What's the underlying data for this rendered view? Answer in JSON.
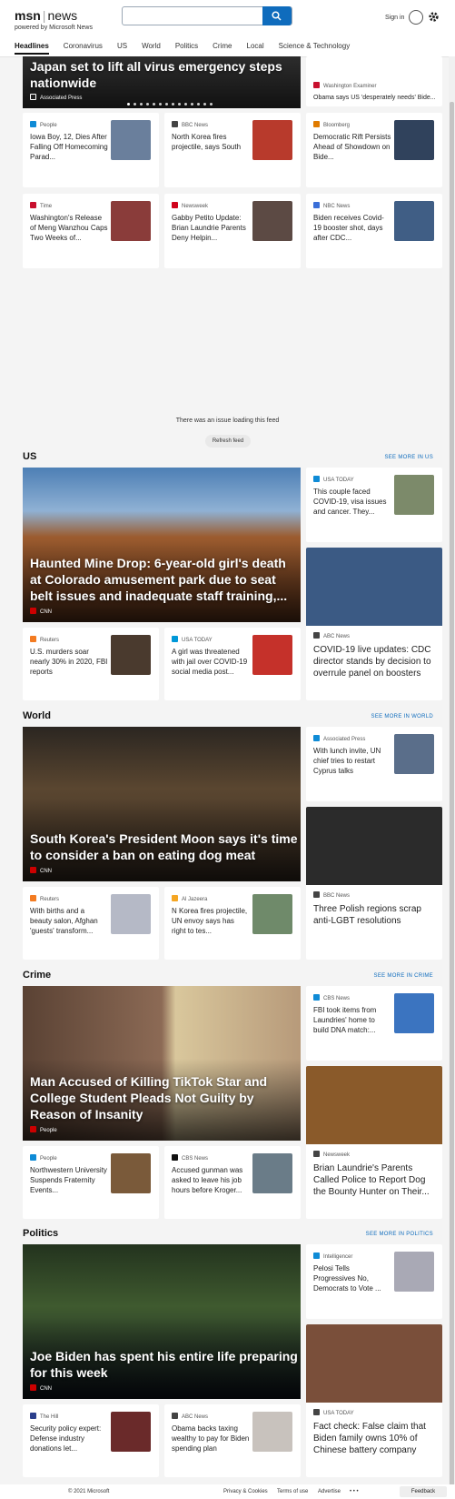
{
  "header": {
    "logo_brand": "msn",
    "logo_section": "news",
    "powered_by": "powered by Microsoft News",
    "search": {
      "value": "",
      "placeholder": ""
    },
    "sign_in": "Sign in"
  },
  "nav": [
    "Headlines",
    "Coronavirus",
    "US",
    "World",
    "Politics",
    "Crime",
    "Local",
    "Science & Technology"
  ],
  "top": {
    "hero_title": "Japan set to lift all virus emergency steps nationwide",
    "hero_source": "Associated Press",
    "side": {
      "source": "Washington Examiner",
      "title": "Obama says US 'desperately needs' Bide..."
    },
    "row1": [
      {
        "source": "People",
        "title": "Iowa Boy, 12, Dies After Falling Off Homecoming Parad..."
      },
      {
        "source": "BBC News",
        "title": "North Korea fires projectile, says South"
      },
      {
        "source": "Bloomberg",
        "title": "Democratic Rift Persists Ahead of Showdown on Bide..."
      }
    ],
    "row2": [
      {
        "source": "Time",
        "title": "Washington's Release of Meng Wanzhou Caps Two Weeks of..."
      },
      {
        "source": "Newsweek",
        "title": "Gabby Petito Update: Brian Laundrie Parents Deny Helpin..."
      },
      {
        "source": "NBC News",
        "title": "Biden receives Covid-19 booster shot, days after CDC..."
      }
    ]
  },
  "feed": {
    "issue": "There was an issue loading this feed",
    "refresh": "Refresh feed"
  },
  "sections": [
    {
      "name": "US",
      "more": "SEE MORE IN US",
      "hero_title": "Haunted Mine Drop: 6-year-old girl's death at Colorado amusement park due to seat belt issues and inadequate staff training,...",
      "hero_source": "CNN",
      "side1": {
        "source": "USA TODAY",
        "title": "This couple faced COVID-19, visa issues and cancer. They..."
      },
      "side2": {
        "source": "ABC News",
        "title": "COVID-19 live updates: CDC director stands by decision to overrule panel on boosters"
      },
      "small": [
        {
          "source": "Reuters",
          "title": "U.S. murders soar nearly 30% in 2020, FBI reports"
        },
        {
          "source": "USA TODAY",
          "title": "A girl was threatened with jail over COVID-19 social media post..."
        }
      ]
    },
    {
      "name": "World",
      "more": "SEE MORE IN WORLD",
      "hero_title": "South Korea's President Moon says it's time to consider a ban on eating dog meat",
      "hero_source": "CNN",
      "side1": {
        "source": "Associated Press",
        "title": "With lunch invite, UN chief tries to restart Cyprus talks"
      },
      "side2": {
        "source": "BBC News",
        "title": "Three Polish regions scrap anti-LGBT resolutions"
      },
      "small": [
        {
          "source": "Reuters",
          "title": "With births and a beauty salon, Afghan 'guests' transform..."
        },
        {
          "source": "Al Jazeera",
          "title": "N Korea fires projectile, UN envoy says has right to tes..."
        }
      ]
    },
    {
      "name": "Crime",
      "more": "SEE MORE IN CRIME",
      "hero_title": "Man Accused of Killing TikTok Star and College Student Pleads Not Guilty by Reason of Insanity",
      "hero_source": "People",
      "side1": {
        "source": "CBS News",
        "title": "FBI took items from Laundries' home to build DNA match:..."
      },
      "side2": {
        "source": "Newsweek",
        "title": "Brian Laundrie's Parents Called Police to Report Dog the Bounty Hunter on Their..."
      },
      "small": [
        {
          "source": "People",
          "title": "Northwestern University Suspends Fraternity Events..."
        },
        {
          "source": "CBS News",
          "title": "Accused gunman was asked to leave his job hours before Kroger..."
        }
      ]
    },
    {
      "name": "Politics",
      "more": "SEE MORE IN POLITICS",
      "hero_title": "Joe Biden has spent his entire life preparing for this week",
      "hero_source": "CNN",
      "side1": {
        "source": "Intelligencer",
        "title": "Pelosi Tells Progressives No, Democrats to Vote ..."
      },
      "side2": {
        "source": "USA TODAY",
        "title": "Fact check: False claim that Biden family owns 10% of Chinese battery company"
      },
      "small": [
        {
          "source": "The Hill",
          "title": "Security policy expert: Defense industry donations let..."
        },
        {
          "source": "ABC News",
          "title": "Obama backs taxing wealthy to pay for Biden spending plan"
        }
      ]
    }
  ],
  "footer": {
    "copyright": "© 2021 Microsoft",
    "privacy": "Privacy & Cookies",
    "terms": "Terms of use",
    "advertise": "Advertise",
    "more": "• • •",
    "feedback": "Feedback"
  },
  "colors": {
    "accent": "#0f6cbd",
    "cnn": "#cc0000"
  }
}
